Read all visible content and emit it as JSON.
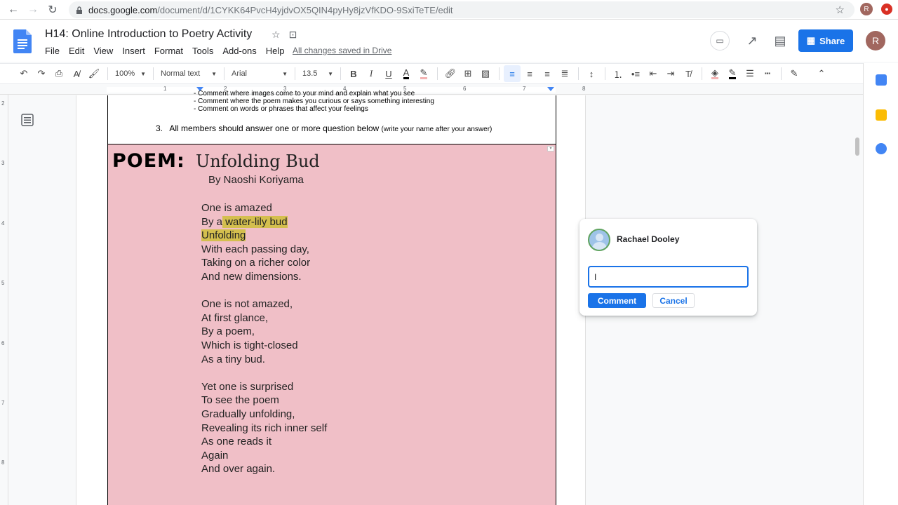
{
  "browser": {
    "url_host": "docs.google.com",
    "url_path": "/document/d/1CYKK64PvcH4yjdvOX5QIN4pyHy8jzVfKDO-9SxiTeTE/edit",
    "profile_initial": "R"
  },
  "doc": {
    "title": "H14: Online Introduction to Poetry Activity",
    "menu": [
      "File",
      "Edit",
      "View",
      "Insert",
      "Format",
      "Tools",
      "Add-ons",
      "Help"
    ],
    "saved_status": "All changes saved in Drive",
    "share_label": "Share",
    "avatar_initial": "R"
  },
  "toolbar": {
    "zoom": "100%",
    "style": "Normal text",
    "font": "Arial",
    "font_size": "13.5"
  },
  "ruler": {
    "numbers": [
      "1",
      "2",
      "3",
      "4",
      "5",
      "6",
      "7",
      "8"
    ]
  },
  "vruler": {
    "numbers": [
      "2",
      "3",
      "4",
      "5",
      "6",
      "7",
      "8"
    ]
  },
  "content": {
    "bullets": [
      "Comment where images come to your mind and explain what you see",
      "Comment where the poem makes you curious or says something interesting",
      "Comment on words or phrases that affect your feelings"
    ],
    "q3_number": "3.",
    "q3_text": "All members should answer one or more question below",
    "q3_note": "(write your name after your answer)",
    "poem_label": "POEM:",
    "poem_title": "Unfolding Bud",
    "poem_author": "By Naoshi Koriyama",
    "poem_lines": [
      "One is amazed",
      "By a water-lily bud",
      "Unfolding",
      "With each passing day,",
      "Taking on a richer color",
      "And new dimensions.",
      "",
      "One is not amazed,",
      "At first glance,",
      "By a poem,",
      "Which is tight-closed",
      "As a tiny bud.",
      "",
      "Yet one is surprised",
      "To see the poem",
      "Gradually unfolding,",
      "Revealing its rich inner self",
      "As one reads it",
      "Again",
      "And over again."
    ],
    "highlight_a_prefix": "By a",
    "highlight_a": " water-lily bud ",
    "highlight_b": "Unfolding",
    "highlight_color": "#d4bf4e"
  },
  "comment": {
    "author": "Rachael Dooley",
    "input_value": "I",
    "comment_label": "Comment",
    "cancel_label": "Cancel"
  },
  "colors": {
    "accent": "#1a73e8",
    "pink_cell": "#f0bfc7"
  }
}
